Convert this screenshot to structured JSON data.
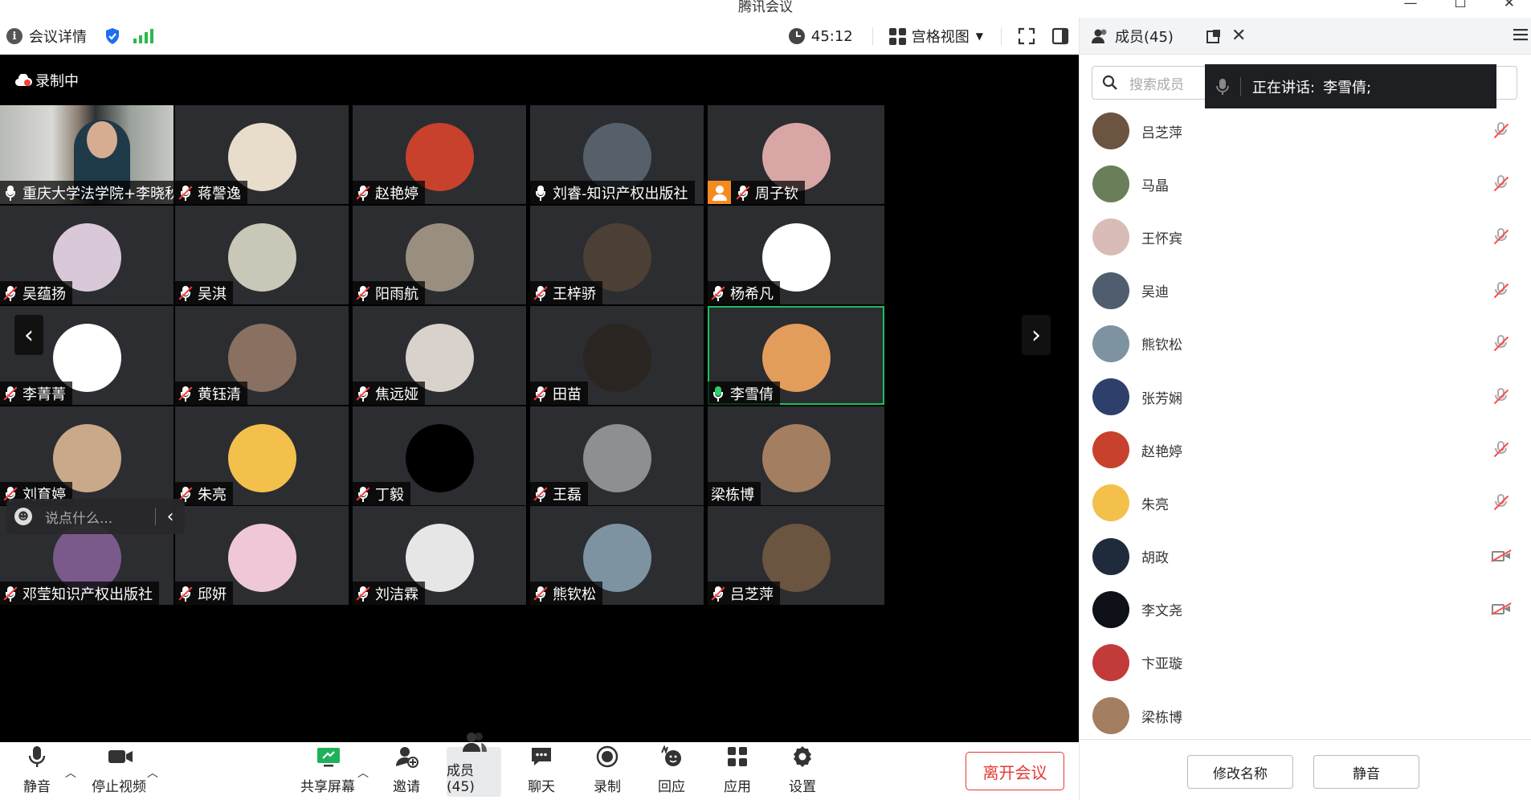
{
  "window": {
    "title": "腾讯会议",
    "minimize": "—",
    "maximize": "☐",
    "close": "✕"
  },
  "topbar": {
    "meeting_details": "会议详情",
    "timer": "45:12",
    "view_mode": "宫格视图"
  },
  "recording": {
    "label": "录制中"
  },
  "tiles": [
    {
      "name": "重庆大学法学院+李晓秋",
      "mic": "on",
      "video": true
    },
    {
      "name": "蒋謦逸",
      "mic": "muted",
      "avatar_color": "#e8dccb"
    },
    {
      "name": "赵艳婷",
      "mic": "muted",
      "avatar_color": "#c8412c"
    },
    {
      "name": "刘睿-知识产权出版社",
      "mic": "on-white",
      "avatar_color": "#55606a"
    },
    {
      "name": "周子钦",
      "mic": "muted",
      "avatar_color": "#d9a6a6",
      "badge": "person"
    },
    {
      "name": "吴蕴扬",
      "mic": "muted",
      "avatar_color": "#d8c8d8"
    },
    {
      "name": "吴淇",
      "mic": "muted",
      "avatar_color": "#c9c7b7"
    },
    {
      "name": "阳雨航",
      "mic": "muted",
      "avatar_color": "#9a8f7f"
    },
    {
      "name": "王梓骄",
      "mic": "muted",
      "avatar_color": "#4c3f35"
    },
    {
      "name": "杨希凡",
      "mic": "muted",
      "avatar_color": "#ffffff"
    },
    {
      "name": "李菁菁",
      "mic": "muted",
      "avatar_color": "#ffffff"
    },
    {
      "name": "黄钰清",
      "mic": "muted",
      "avatar_color": "#8a7060"
    },
    {
      "name": "焦远娅",
      "mic": "muted",
      "avatar_color": "#d9d2cc"
    },
    {
      "name": "田苗",
      "mic": "muted",
      "avatar_color": "#2a2520"
    },
    {
      "name": "李雪倩",
      "mic": "speaking",
      "avatar_color": "#e39d5a"
    },
    {
      "name": "刘育婷",
      "mic": "muted",
      "avatar_color": "#c9a98a"
    },
    {
      "name": "朱亮",
      "mic": "muted",
      "avatar_color": "#f4c04c"
    },
    {
      "name": "丁毅",
      "mic": "muted",
      "avatar_color": "#000000"
    },
    {
      "name": "王磊",
      "mic": "muted",
      "avatar_color": "#8d8f93"
    },
    {
      "name": "梁栋博",
      "mic": "none",
      "avatar_color": "#a47e60"
    },
    {
      "name": "邓莹知识产权出版社",
      "mic": "muted",
      "avatar_color": "#7a5a8a"
    },
    {
      "name": "邱妍",
      "mic": "muted",
      "avatar_color": "#efc7d6"
    },
    {
      "name": "刘洁霖",
      "mic": "muted",
      "avatar_color": "#e6e6e6"
    },
    {
      "name": "熊钦松",
      "mic": "muted",
      "avatar_color": "#7e93a1"
    },
    {
      "name": "吕芝萍",
      "mic": "muted",
      "avatar_color": "#6b5440"
    }
  ],
  "chat": {
    "placeholder": "说点什么..."
  },
  "bottombar": {
    "mute": "静音",
    "stop_video": "停止视频",
    "share_screen": "共享屏幕",
    "invite": "邀请",
    "members": "成员(45)",
    "chat": "聊天",
    "record": "录制",
    "react": "回应",
    "apps": "应用",
    "settings": "设置",
    "leave": "离开会议"
  },
  "panel": {
    "title": "成员(45)",
    "search_placeholder": "搜索成员",
    "speaking_label": "正在讲话:",
    "speaking_name": "李雪倩;",
    "rename": "修改名称",
    "mute": "静音",
    "members": [
      {
        "name": "吕芝萍",
        "status": "muted",
        "avatar_color": "#6b5440"
      },
      {
        "name": "马晶",
        "status": "muted",
        "avatar_color": "#6a7e5a"
      },
      {
        "name": "王怀宾",
        "status": "muted",
        "avatar_color": "#d9bcb7"
      },
      {
        "name": "吴迪",
        "status": "muted",
        "avatar_color": "#4f5d6e"
      },
      {
        "name": "熊钦松",
        "status": "muted",
        "avatar_color": "#7e93a1"
      },
      {
        "name": "张芳娴",
        "status": "muted",
        "avatar_color": "#2f3f6b"
      },
      {
        "name": "赵艳婷",
        "status": "muted",
        "avatar_color": "#c8412c"
      },
      {
        "name": "朱亮",
        "status": "muted",
        "avatar_color": "#f4c04c"
      },
      {
        "name": "胡政",
        "status": "camera-off",
        "avatar_color": "#1f2a3a"
      },
      {
        "name": "李文尧",
        "status": "camera-off",
        "avatar_color": "#0e1118"
      },
      {
        "name": "卞亚璇",
        "status": "none",
        "avatar_color": "#c23a3a"
      },
      {
        "name": "梁栋博",
        "status": "none",
        "avatar_color": "#a47e60"
      }
    ]
  }
}
